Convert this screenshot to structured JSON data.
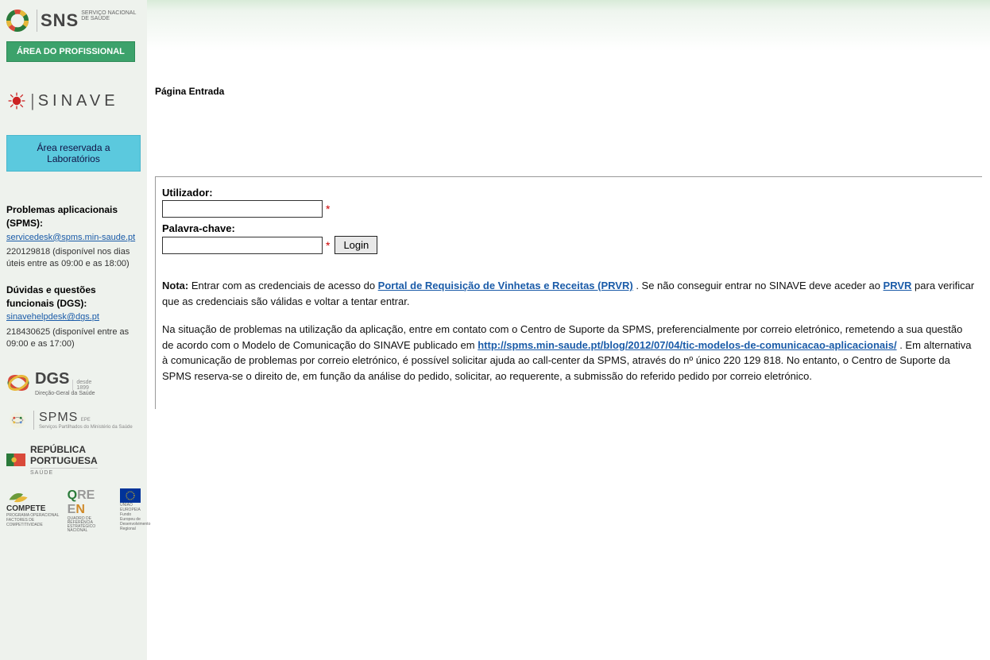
{
  "header": {
    "sns_main": "SNS",
    "sns_sub1": "SERVIÇO NACIONAL",
    "sns_sub2": "DE SAÚDE"
  },
  "sidebar": {
    "btn_prof": "ÁREA DO PROFISSIONAL",
    "sinave": "SINAVE",
    "btn_lab": "Área reservada a Laboratórios",
    "support1": {
      "title": "Problemas aplicacionais (SPMS):",
      "email": "servicedesk@spms.min-saude.pt",
      "phone": "220129818 (disponível nos dias úteis entre as 09:00 e as 18:00)"
    },
    "support2": {
      "title": "Dúvidas e questões funcionais (DGS):",
      "email": "sinavehelpdesk@dgs.pt",
      "phone": "218430625 (disponível entre as 09:00 e as 17:00)"
    },
    "dgs": {
      "main": "DGS",
      "sub": "Direção-Geral da Saúde",
      "year_label": "desde",
      "year": "1899"
    },
    "spms": {
      "main": "SPMS",
      "suffix": "EPE",
      "sub": "Serviços Partilhados do Ministério da Saúde"
    },
    "rp": {
      "line1a": "REPÚBLICA",
      "line1b": "PORTUGUESA",
      "line2": "SAÚDE"
    },
    "compete": {
      "text": "COMPETE",
      "sub": "PROGRAMA OPERACIONAL FACTORES DE COMPETITIVIDADE"
    },
    "qren": {
      "q": "Q",
      "re": "RE",
      "n": "N",
      "sub": "QUADRO DE REFERÊNCIA ESTRATÉGICO NACIONAL"
    },
    "eu": {
      "line1": "UNIÃO EUROPEIA",
      "line2": "Fundo Europeu de Desenvolvimento Regional"
    }
  },
  "main": {
    "page_title": "Página Entrada",
    "form": {
      "user_label": "Utilizador:",
      "pass_label": "Palavra-chave:",
      "login_btn": "Login",
      "required": "*"
    },
    "note": {
      "label": "Nota:",
      "p1a": " Entrar com as credenciais de acesso do ",
      "link1": "Portal de Requisição de Vinhetas e Receitas (PRVR)",
      "p1b": " . Se não conseguir entrar no SINAVE deve aceder ao ",
      "link2": "PRVR",
      "p1c": " para verificar que as credenciais são válidas e voltar a tentar entrar.",
      "p2a": "Na situação de problemas na utilização da aplicação, entre em contato com o Centro de Suporte da SPMS, preferencialmente por correio eletrónico, remetendo a sua questão de acordo com o Modelo de Comunicação do SINAVE publicado em ",
      "link3": "http://spms.min-saude.pt/blog/2012/07/04/tic-modelos-de-comunicacao-aplicacionais/",
      "p2b": " . Em alternativa à comunicação de problemas por correio eletrónico, é possível solicitar ajuda ao call-center da SPMS, através do nº único 220 129 818. No entanto, o Centro de Suporte da SPMS reserva-se o direito de, em função da análise do pedido, solicitar, ao requerente, a submissão do referido pedido por correio eletrónico."
    }
  }
}
